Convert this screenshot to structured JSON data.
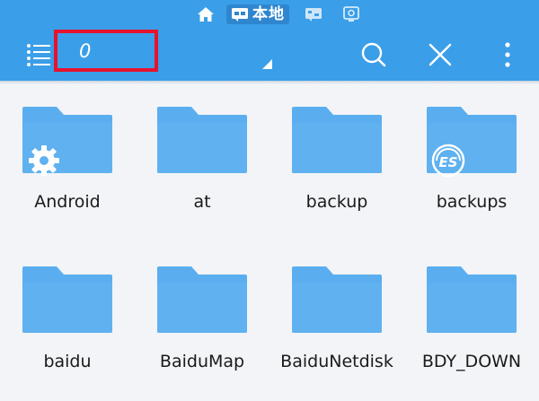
{
  "status_bar": {
    "tabs": [
      {
        "icon": "home-icon",
        "label": ""
      },
      {
        "icon": "local-storage-icon",
        "label": "本地",
        "active": true
      },
      {
        "icon": "network-icon",
        "label": ""
      },
      {
        "icon": "remote-icon",
        "label": ""
      }
    ]
  },
  "toolbar": {
    "menu_icon": "menu-list-icon",
    "path_value": "0",
    "search_icon": "search-icon",
    "close_icon": "close-icon",
    "more_icon": "more-vertical-icon"
  },
  "highlight": {
    "border_color": "#e5132d"
  },
  "colors": {
    "toolbar": "#3b9ee8",
    "folder": "#5aaeef",
    "background": "#f2f4f7"
  },
  "folders": [
    {
      "name": "Android",
      "badge": "gear-icon"
    },
    {
      "name": "at",
      "badge": ""
    },
    {
      "name": "backup",
      "badge": ""
    },
    {
      "name": "backups",
      "badge": "es-logo-icon"
    },
    {
      "name": "baidu",
      "badge": ""
    },
    {
      "name": "BaiduMap",
      "badge": ""
    },
    {
      "name": "BaiduNetdisk",
      "badge": ""
    },
    {
      "name": "BDY_DOWN",
      "badge": ""
    }
  ]
}
